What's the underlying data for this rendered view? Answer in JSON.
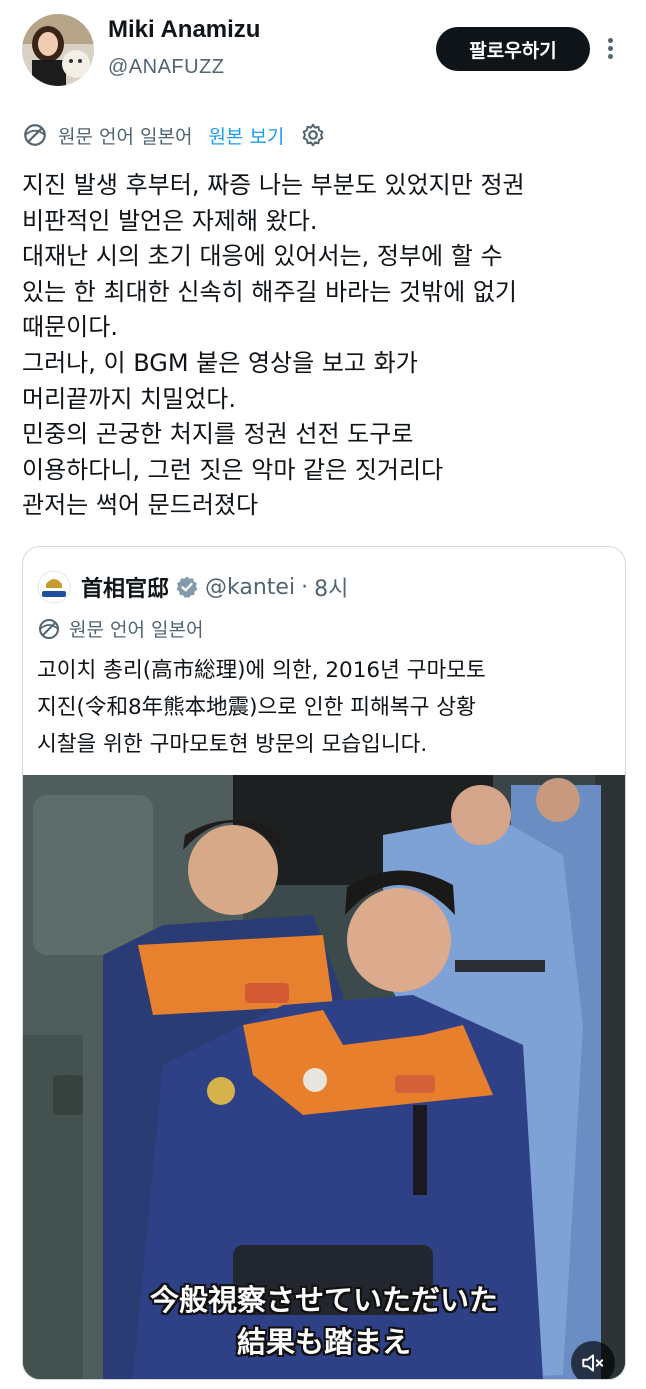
{
  "author": {
    "display_name": "Miki Anamizu",
    "handle": "@ANAFUZZ",
    "follow_label": "팔로우하기"
  },
  "translation": {
    "language_note": "원문 언어 일본어",
    "show_original": "원본 보기"
  },
  "tweet": {
    "lines": [
      "지진 발생 후부터, 짜증 나는 부분도 있었지만 정권",
      "비판적인 발언은 자제해 왔다.",
      "대재난 시의 초기 대응에 있어서는, 정부에 할 수",
      "있는 한 최대한 신속히 해주길 바라는 것밖에 없기",
      "때문이다.",
      "그러나, 이 BGM 붙은 영상을 보고 화가",
      "머리끝까지 치밀었다.",
      "민중의 곤궁한 처지를 정권 선전 도구로",
      "이용하다니, 그런 짓은 악마 같은 짓거리다",
      "관저는 썩어 문드러졌다"
    ]
  },
  "quote": {
    "name": "首相官邸",
    "handle": "@kantei",
    "separator": "·",
    "time": "8시",
    "language_note": "원문 언어 일본어",
    "lines": [
      "고이치 총리(高市総理)에 의한, 2016년 구마모토",
      "지진(令和8年熊本地震)으로 인한 피해복구 상황",
      "시찰을 위한 구마모토현 방문의 모습입니다."
    ],
    "video": {
      "caption_line1": "今般視察させていただいた",
      "caption_line2": "結果も踏まえ",
      "sound": "muted"
    }
  },
  "colors": {
    "link": "#1d9bf0",
    "text": "#0f1419",
    "secondary": "#536471",
    "border": "#cfd9de"
  }
}
